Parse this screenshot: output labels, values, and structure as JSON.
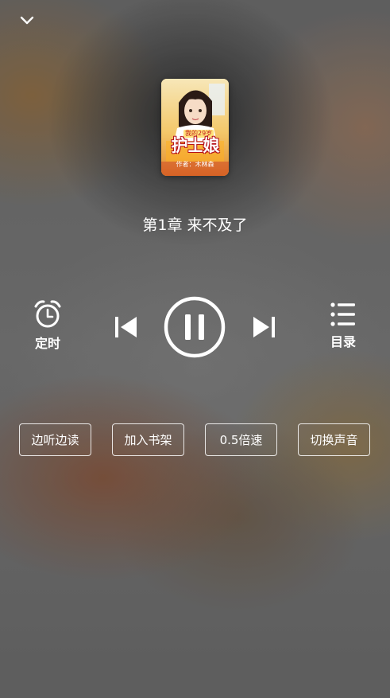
{
  "book": {
    "cover_title": "护士娘",
    "cover_subtitle": "我的29岁",
    "cover_author": "作者：木林森"
  },
  "chapter": {
    "title": "第1章 来不及了"
  },
  "controls": {
    "timer_label": "定时",
    "toc_label": "目录",
    "playing": true
  },
  "actions": [
    {
      "label": "边听边读"
    },
    {
      "label": "加入书架"
    },
    {
      "label": "0.5倍速"
    },
    {
      "label": "切换声音"
    }
  ],
  "icons": {
    "collapse": "chevron-down-icon",
    "timer": "alarm-clock-icon",
    "prev": "skip-previous-icon",
    "pause": "pause-icon",
    "next": "skip-next-icon",
    "toc": "list-icon"
  }
}
